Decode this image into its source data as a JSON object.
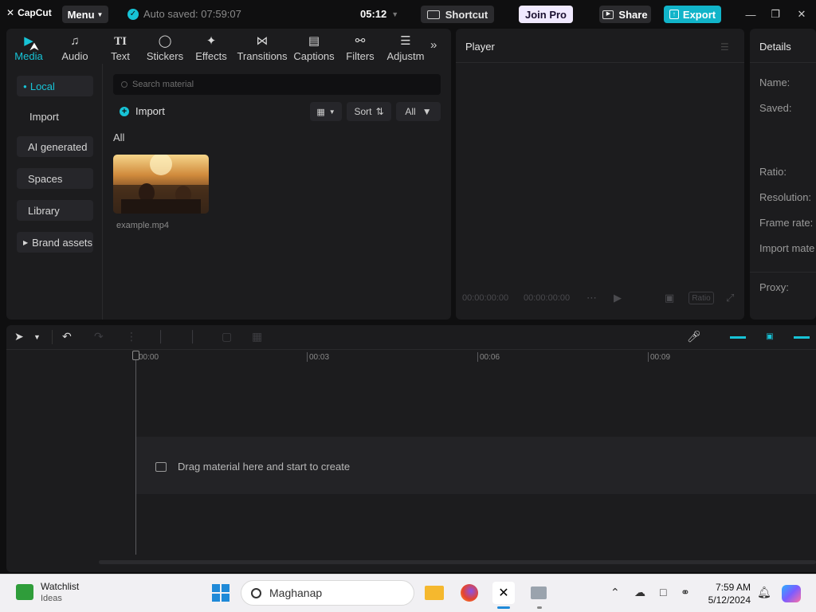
{
  "titlebar": {
    "logo": "CapCut",
    "menu_label": "Menu",
    "autosave": "Auto saved: 07:59:07",
    "version": "05:12",
    "shortcut_label": "Shortcut",
    "joinpro_label": "Join Pro",
    "share_label": "Share",
    "export_label": "Export"
  },
  "tooltabs": [
    {
      "label": "Media",
      "icon": "media-icon",
      "active": true
    },
    {
      "label": "Audio",
      "icon": "audio-icon"
    },
    {
      "label": "Text",
      "icon": "text-icon"
    },
    {
      "label": "Stickers",
      "icon": "stickers-icon"
    },
    {
      "label": "Effects",
      "icon": "effects-icon"
    },
    {
      "label": "Transitions",
      "icon": "transitions-icon"
    },
    {
      "label": "Captions",
      "icon": "captions-icon"
    },
    {
      "label": "Filters",
      "icon": "filters-icon"
    },
    {
      "label": "Adjustm",
      "icon": "adjustment-icon"
    }
  ],
  "sidebar": {
    "items": [
      {
        "label": "Local"
      },
      {
        "label": "Import"
      },
      {
        "label": "AI generated"
      },
      {
        "label": "Spaces"
      },
      {
        "label": "Library"
      },
      {
        "label": "Brand assets"
      }
    ]
  },
  "media": {
    "search_placeholder": "Search material",
    "import_label": "Import",
    "sort_label": "Sort",
    "filter_label": "All",
    "section_label": "All",
    "items": [
      {
        "name": "example.mp4"
      }
    ]
  },
  "player": {
    "title": "Player",
    "timecode_current": "00:00:00:00",
    "timecode_total": "00:00:00:00",
    "ratio_label": "Ratio"
  },
  "details": {
    "title": "Details",
    "labels": [
      "Name:",
      "Saved:",
      "Ratio:",
      "Resolution:",
      "Frame rate:",
      "Import mate",
      "Proxy:"
    ]
  },
  "timeline": {
    "ruler": [
      "00:00",
      "00:03",
      "00:06",
      "00:09"
    ],
    "empty_message": "Drag material here and start to create"
  },
  "taskbar": {
    "widget_title": "Watchlist",
    "widget_sub": "Ideas",
    "search_text": "Maghanap",
    "time": "7:59 AM",
    "date": "5/12/2024"
  }
}
